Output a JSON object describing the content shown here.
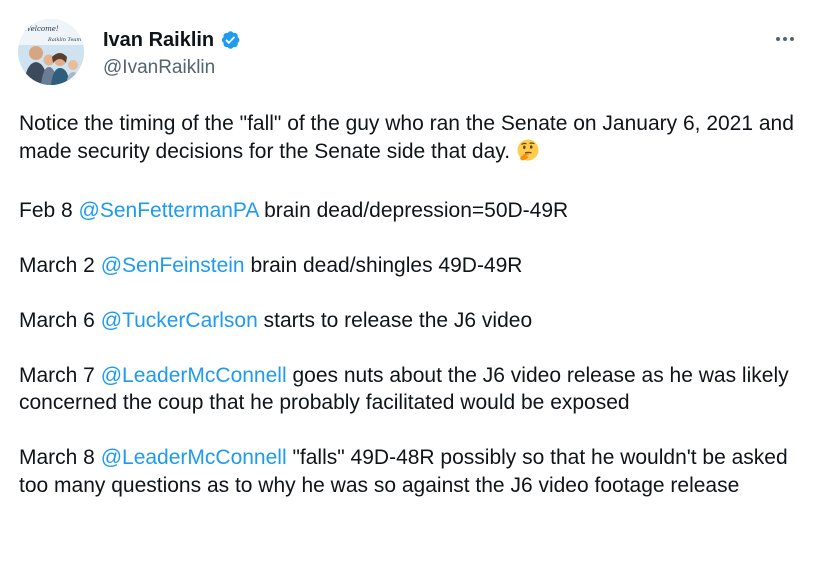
{
  "author": {
    "name": "Ivan Raiklin",
    "handle": "@IvanRaiklin",
    "verified": true,
    "avatar_caption": "Welcome! Raiklin Team"
  },
  "colors": {
    "text": "#0f1419",
    "secondary": "#536471",
    "link": "#1d9bf0"
  },
  "icons": {
    "verified": "verified-badge-icon",
    "more": "more-options-icon",
    "emoji": "thinking-face-emoji"
  },
  "tweet": {
    "intro": "Notice the timing of the \"fall\" of the guy who ran the Senate on January 6, 2021 and made security decisions for the Senate side that day.",
    "p1_date": "Feb 8",
    "p1_mention": "@SenFettermanPA",
    "p1_text": "brain dead/depression=50D-49R",
    "p2_date": "March 2",
    "p2_mention": "@SenFeinstein",
    "p2_text": "brain dead/shingles 49D-49R",
    "p3_date": "March 6",
    "p3_mention": "@TuckerCarlson",
    "p3_text": "starts to release the J6 video",
    "p4_date": "March 7",
    "p4_mention": "@LeaderMcConnell",
    "p4_text": "goes nuts about the J6 video release as he was likely concerned the coup that he probably facilitated would be exposed",
    "p5_date": "March 8",
    "p5_mention": "@LeaderMcConnell",
    "p5_text": "\"falls\" 49D-48R possibly so that he wouldn't be asked too many questions as to why he was so against the J6 video footage release"
  }
}
